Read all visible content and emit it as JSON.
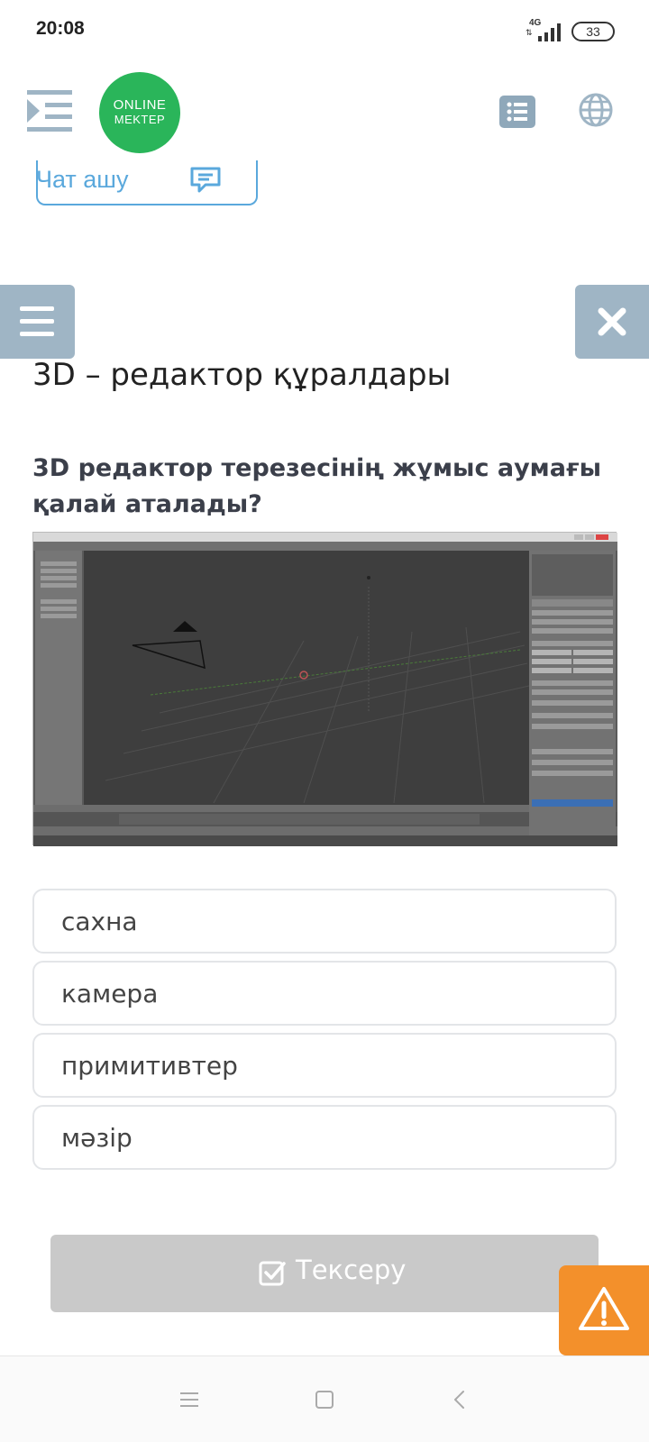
{
  "status_bar": {
    "time": "20:08",
    "network": "4G",
    "battery": "33"
  },
  "header": {
    "logo_line1": "ONLINE",
    "logo_line2": "MEKTEP",
    "menu_icon": "indent-menu-icon",
    "list_icon": "list-icon",
    "globe_icon": "globe-icon"
  },
  "chat": {
    "label": "Чат ашу",
    "icon": "chat-bubble-icon"
  },
  "lesson": {
    "title": "3D – редактор құралдары",
    "question": "3D редактор терезесінің жұмыс аумағы қалай аталады?"
  },
  "options": [
    {
      "label": "сахна"
    },
    {
      "label": "камера"
    },
    {
      "label": "примитивтер"
    },
    {
      "label": "мәзір"
    }
  ],
  "check_button": {
    "label": "Тексеру",
    "icon": "checkbox-icon"
  },
  "colors": {
    "brand_green": "#2ab55a",
    "accent_blue": "#5aa8dc",
    "side_button": "#9fb5c5",
    "warning_orange": "#f3902b",
    "disabled_gray": "#c9c9c9"
  }
}
